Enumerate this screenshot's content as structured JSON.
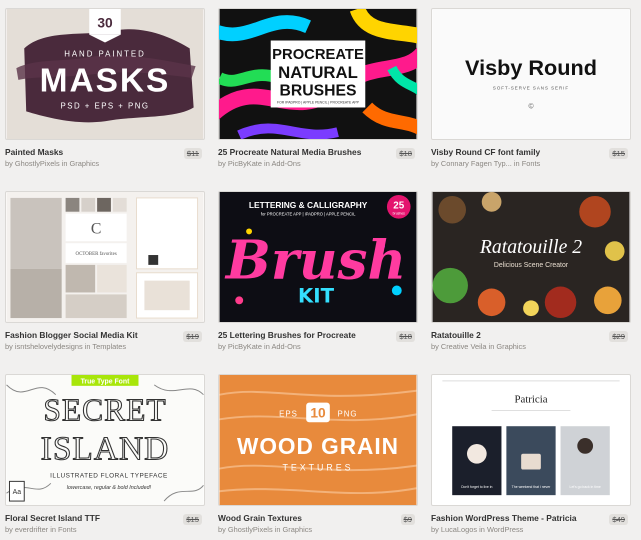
{
  "products": [
    {
      "title": "Painted Masks",
      "by": "by",
      "author": "GhostlyPixels",
      "in": "in",
      "category": "Graphics",
      "price": "$11",
      "thumb": {
        "badge": "30",
        "line1": "HAND PAINTED",
        "line2": "MASKS",
        "line3": "PSD + EPS + PNG"
      }
    },
    {
      "title": "25 Procreate Natural Media Brushes",
      "by": "by",
      "author": "PicByKate",
      "in": "in",
      "category": "Add-Ons",
      "price": "$18",
      "thumb": {
        "line1": "PROCREATE",
        "line2": "NATURAL",
        "line3": "BRUSHES",
        "line4": "FOR IPADPRO | APPLE PENCIL | PROCREATE APP"
      }
    },
    {
      "title": "Visby Round CF font family",
      "by": "by",
      "author": "Connary Fagen Typ...",
      "in": "in",
      "category": "Fonts",
      "price": "$15",
      "thumb": {
        "line1": "Visby Round",
        "line2": "SOFT-SERVE SANS SERIF",
        "line3": "©"
      }
    },
    {
      "title": "Fashion Blogger Social Media Kit",
      "by": "by",
      "author": "isntshelovelydesigns",
      "in": "in",
      "category": "Templates",
      "price": "$19",
      "thumb": {
        "letter": "C",
        "line1": "OCTOBER favorites"
      }
    },
    {
      "title": "25 Lettering Brushes for Procreate",
      "by": "by",
      "author": "PicByKate",
      "in": "in",
      "category": "Add-Ons",
      "price": "$18",
      "thumb": {
        "line1": "LETTERING & CALLIGRAPHY",
        "line2": "for PROCREATE APP | IPADPRO | APPLE PENCIL",
        "line3": "Brush",
        "line4": "KIT",
        "badge": "25",
        "badge_sub": "brushes"
      }
    },
    {
      "title": "Ratatouille 2",
      "by": "by",
      "author": "Creative Veila",
      "in": "in",
      "category": "Graphics",
      "price": "$29",
      "thumb": {
        "line1": "Ratatouille 2",
        "line2": "Delicious Scene Creator"
      }
    },
    {
      "title": "Floral Secret Island TTF",
      "by": "by",
      "author": "everdrifter",
      "in": "in",
      "category": "Fonts",
      "price": "$15",
      "thumb": {
        "banner": "True Type Font",
        "line1": "SECRET",
        "line2": "ISLAND",
        "line3": "ILLUSTRATED FLORAL TYPEFACE",
        "line4": "lowercase, regular & bold Included!",
        "icon_label": "Aa"
      }
    },
    {
      "title": "Wood Grain Textures",
      "by": "by",
      "author": "GhostlyPixels",
      "in": "in",
      "category": "Graphics",
      "price": "$9",
      "thumb": {
        "left": "EPS",
        "num": "10",
        "right": "PNG",
        "line1": "WOOD GRAIN",
        "line2": "TEXTURES"
      }
    },
    {
      "title": "Fashion WordPress Theme - Patricia",
      "by": "by",
      "author": "LucaLogos",
      "in": "in",
      "category": "WordPress",
      "price": "$49",
      "thumb": {
        "line1": "Patricia",
        "cap1": "Don't forget to live in",
        "cap2": "The weekend that i never",
        "cap3": "Let's go back in time"
      }
    }
  ],
  "colors": {
    "bg": "#f1f0ef",
    "title": "#333333",
    "meta": "#8b8782",
    "lime": "#a8e60a"
  }
}
